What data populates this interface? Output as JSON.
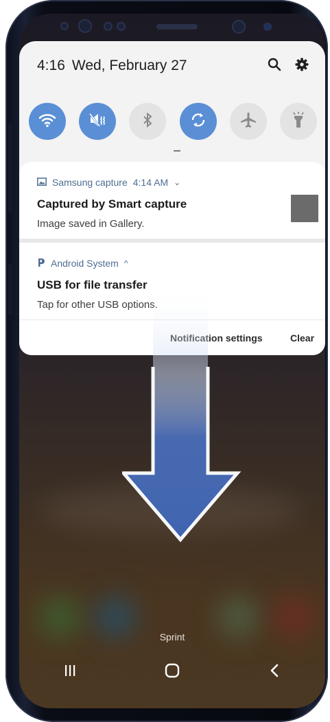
{
  "status": {
    "time": "4:16",
    "date": "Wed, February 27",
    "icons": [
      "search-icon",
      "gear-icon"
    ]
  },
  "quick_settings": [
    {
      "name": "wifi",
      "icon": "wifi-icon",
      "state": "on"
    },
    {
      "name": "mute",
      "icon": "mute-icon",
      "state": "on"
    },
    {
      "name": "bluetooth",
      "icon": "bluetooth-icon",
      "state": "off"
    },
    {
      "name": "auto-rotate",
      "icon": "auto-rotate-icon",
      "state": "on"
    },
    {
      "name": "airplane-mode",
      "icon": "airplane-icon",
      "state": "off"
    },
    {
      "name": "flashlight",
      "icon": "flashlight-icon",
      "state": "off"
    }
  ],
  "notifications": [
    {
      "app": "Samsung capture",
      "time": "4:14 AM",
      "chevron": "⌄",
      "title": "Captured by Smart capture",
      "body": "Image saved in Gallery.",
      "icon": "image-icon"
    },
    {
      "app": "Android System",
      "chevron": "^",
      "title": "USB for file transfer",
      "body": "Tap for other USB options.",
      "icon": "android-system-icon"
    }
  ],
  "actions": {
    "settings": "Notification settings",
    "clear": "Clear"
  },
  "carrier": "Sprint",
  "nav": [
    "recents-icon",
    "home-icon",
    "back-icon"
  ],
  "colors": {
    "accent": "#5a8fd6",
    "arrow": "#3f64b0",
    "app_label": "#4e6d93"
  }
}
